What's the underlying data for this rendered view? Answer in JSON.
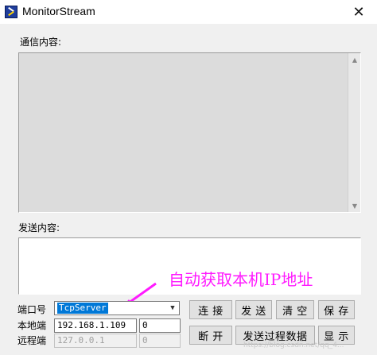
{
  "window": {
    "title": "MonitorStream",
    "close_glyph": "✕"
  },
  "comm_section": {
    "label": "通信内容:"
  },
  "send_section": {
    "label": "发送内容:"
  },
  "fields": {
    "port_label": "端口号",
    "port_value": "TcpServer",
    "local_label": "本地端",
    "local_ip": "192.168.1.109",
    "local_port": "0",
    "remote_label": "远程端",
    "remote_ip": "127.0.0.1",
    "remote_port": "0"
  },
  "buttons": {
    "connect": "连 接",
    "send": "发 送",
    "clear": "清 空",
    "save": "保 存",
    "disconnect": "断 开",
    "send_process_data": "发送过程数据",
    "display": "显 示"
  },
  "annotation": {
    "text": "自动获取本机IP地址",
    "color": "#ff1aff"
  },
  "watermark": {
    "text": "https://blog.csdn.net/qq_4..."
  },
  "icons": {
    "app": "app-icon",
    "close": "close-icon",
    "scroll_up": "scroll-up-icon",
    "scroll_down": "scroll-down-icon",
    "combo": "chevron-down-icon"
  }
}
